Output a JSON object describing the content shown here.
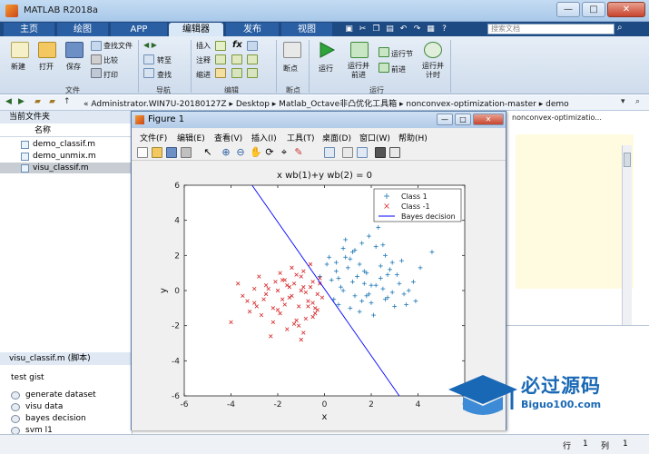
{
  "window": {
    "title": "MATLAB R2018a",
    "controls": [
      "—",
      "□",
      "✕"
    ]
  },
  "ribbon_tabs": [
    "主页",
    "绘图",
    "APP",
    "编辑器",
    "发布",
    "视图"
  ],
  "search": {
    "placeholder": "搜索文档"
  },
  "ribbon": {
    "file_group": {
      "label": "文件",
      "new": "新建",
      "open": "打开",
      "save": "保存",
      "find_files": "查找文件",
      "compare": "比较",
      "print": "打印"
    },
    "nav_group": {
      "label": "导航",
      "goto": "转至",
      "find": "查找"
    },
    "edit_group": {
      "label": "编辑",
      "insert": "插入",
      "comment": "注释",
      "indent": "缩进",
      "fx": "fx"
    },
    "breakpoints_group": {
      "label": "断点",
      "breakpoints": "断点"
    },
    "run_group": {
      "label": "运行",
      "run": "运行",
      "run_advance": "运行并\n前进",
      "run_section": "运行节",
      "advance": "前进",
      "run_time": "运行并\n计时"
    }
  },
  "address": {
    "path": "« Administrator.WIN7U-20180127Z  ▸  Desktop  ▸  Matlab_Octave非凸优化工具箱  ▸  nonconvex-optimization-master  ▸  demo"
  },
  "current_folder": {
    "header": "当前文件夹",
    "column_name": "名称",
    "files": [
      "demo_classif.m",
      "demo_unmix.m",
      "visu_classif.m"
    ],
    "selected": "visu_classif.m"
  },
  "details": {
    "header": "visu_classif.m  (脚本)",
    "title": "test gist",
    "cells": [
      "generate dataset",
      "visu data",
      "bayes decision",
      "svm l1"
    ]
  },
  "editor": {
    "tab_text": "nonconvex-optimizatio..."
  },
  "status": {
    "row_label": "行",
    "row_value": "1",
    "col_label": "列",
    "col_value": "1"
  },
  "figure": {
    "title": "Figure 1",
    "menu": [
      "文件(F)",
      "编辑(E)",
      "查看(V)",
      "插入(I)",
      "工具(T)",
      "桌面(D)",
      "窗口(W)",
      "帮助(H)"
    ]
  },
  "watermark": {
    "main": "必过源码",
    "sub": "Biguo100.com"
  },
  "chart_data": {
    "type": "scatter",
    "title": "x wb(1)+y wb(2) = 0",
    "xlabel": "x",
    "ylabel": "y",
    "xlim": [
      -6,
      6
    ],
    "ylim": [
      -6,
      6
    ],
    "xticks": [
      -6,
      -4,
      -2,
      0,
      2,
      4,
      6
    ],
    "yticks": [
      -6,
      -4,
      -2,
      0,
      2,
      4,
      6
    ],
    "grid": false,
    "legend_position": "top-right",
    "series": [
      {
        "name": "Class 1",
        "marker": "+",
        "color": "#1f77b4",
        "x": [
          0.5,
          1.2,
          2.0,
          1.6,
          2.4,
          0.8,
          1.9,
          3.1,
          2.7,
          1.1,
          0.3,
          1.5,
          2.2,
          3.4,
          0.9,
          1.7,
          2.9,
          1.3,
          0.6,
          2.5,
          3.8,
          1.0,
          2.1,
          0.2,
          1.4,
          2.6,
          3.0,
          1.8,
          0.7,
          2.3,
          4.6,
          3.6,
          1.6,
          0.4,
          2.8,
          1.2,
          2.0,
          3.3,
          0.1,
          1.9,
          2.4,
          0.8,
          3.9,
          1.5,
          2.7,
          -0.2,
          0.9,
          1.1,
          2.2,
          3.2,
          1.7,
          0.5,
          2.9,
          3.5,
          1.3,
          2.6,
          0.6,
          4.1,
          1.8,
          2.5
        ],
        "y": [
          1.1,
          2.2,
          0.3,
          -0.6,
          1.4,
          0.0,
          3.1,
          0.9,
          -0.4,
          1.8,
          0.6,
          -1.2,
          2.5,
          -0.2,
          2.9,
          0.4,
          1.6,
          -0.3,
          -0.8,
          0.1,
          0.5,
          1.3,
          -1.4,
          1.9,
          0.8,
          2.0,
          -0.9,
          1.0,
          0.2,
          3.6,
          2.2,
          0.0,
          2.7,
          -0.5,
          1.2,
          0.5,
          -0.7,
          1.7,
          1.5,
          -0.2,
          0.7,
          2.4,
          -0.6,
          1.5,
          0.9,
          0.8,
          1.9,
          -1.0,
          0.3,
          0.4,
          1.1,
          1.6,
          -0.1,
          -0.8,
          2.3,
          -0.5,
          0.7,
          1.3,
          -0.3,
          2.6
        ]
      },
      {
        "name": "Class -1",
        "marker": "x",
        "color": "#d62728",
        "x": [
          -1.0,
          -2.0,
          -0.5,
          -1.5,
          -2.5,
          -0.8,
          -1.2,
          -3.0,
          -0.3,
          -1.8,
          -2.2,
          -0.6,
          -1.1,
          -2.8,
          -0.9,
          -1.6,
          -3.5,
          -0.4,
          -2.4,
          -1.3,
          -0.7,
          -1.9,
          -2.6,
          -0.2,
          -1.4,
          -3.2,
          -0.9,
          -2.0,
          -1.7,
          -0.5,
          -4.0,
          -1.0,
          -2.3,
          -0.8,
          -1.5,
          -3.0,
          -0.1,
          -1.2,
          -2.7,
          -0.6,
          -1.8,
          -2.1,
          -0.3,
          -1.1,
          -3.7,
          -0.7,
          -1.6,
          -2.5,
          -0.4,
          -1.3,
          -2.9,
          -0.9,
          -1.9,
          -0.5,
          -2.2,
          -1.4,
          -0.2,
          -3.3,
          -1.0,
          -1.7
        ],
        "y": [
          0.0,
          -1.1,
          0.5,
          -0.4,
          0.3,
          -1.6,
          0.9,
          -0.7,
          -0.2,
          0.6,
          -1.8,
          0.2,
          -0.9,
          0.8,
          1.1,
          -2.2,
          -0.3,
          -1.0,
          0.1,
          0.4,
          -0.6,
          -1.3,
          -0.5,
          0.7,
          1.3,
          -1.2,
          -2.4,
          0.0,
          -0.8,
          -1.5,
          -1.8,
          0.8,
          -2.6,
          -0.1,
          0.2,
          0.1,
          -0.4,
          -1.7,
          -1.4,
          1.5,
          -0.5,
          0.5,
          -1.1,
          -2.0,
          0.4,
          -0.9,
          0.3,
          -0.2,
          -1.3,
          -1.9,
          -0.9,
          0.2,
          1.0,
          -0.7,
          -1.0,
          -0.3,
          0.4,
          -0.6,
          -2.8,
          0.6
        ]
      },
      {
        "name": "Bayes decision",
        "type": "line",
        "color": "#0000ff",
        "x": [
          -3.1,
          3.2
        ],
        "y": [
          6.0,
          -6.0
        ]
      }
    ]
  }
}
